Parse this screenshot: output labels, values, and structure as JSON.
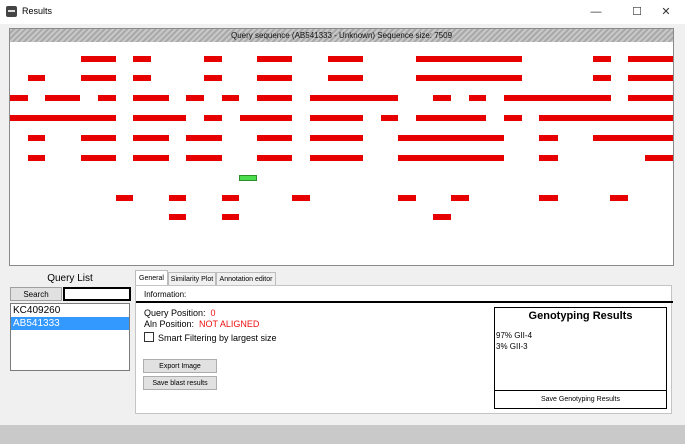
{
  "window": {
    "title": "Results",
    "minimize_glyph": "—",
    "maximize_glyph": "☐",
    "close_glyph": "✕",
    "icon": "app-logo-icon"
  },
  "plot": {
    "header": "Query sequence (AB541333 - Unknown) Sequence size: 7509",
    "red_color": "#e60000",
    "green_color": "#4cdd4c",
    "rows": [
      [
        [
          71,
          106
        ],
        [
          123,
          141
        ],
        [
          194,
          212
        ],
        [
          247,
          282
        ],
        [
          318,
          353
        ],
        [
          406,
          512
        ],
        [
          583,
          601
        ],
        [
          618,
          663
        ]
      ],
      [
        [
          18,
          35
        ],
        [
          71,
          106
        ],
        [
          123,
          141
        ],
        [
          194,
          212
        ],
        [
          247,
          282
        ],
        [
          318,
          353
        ],
        [
          406,
          512
        ],
        [
          583,
          601
        ],
        [
          618,
          663
        ]
      ],
      [
        [
          0,
          18
        ],
        [
          35,
          70
        ],
        [
          88,
          106
        ],
        [
          123,
          159
        ],
        [
          176,
          194
        ],
        [
          212,
          229
        ],
        [
          247,
          282
        ],
        [
          300,
          388
        ],
        [
          423,
          441
        ],
        [
          459,
          476
        ],
        [
          494,
          601
        ],
        [
          618,
          663
        ]
      ],
      [
        [
          0,
          53
        ],
        [
          53,
          106
        ],
        [
          123,
          176
        ],
        [
          194,
          212
        ],
        [
          230,
          282
        ],
        [
          300,
          353
        ],
        [
          371,
          388
        ],
        [
          406,
          476
        ],
        [
          494,
          512
        ],
        [
          529,
          663
        ]
      ],
      [
        [
          18,
          35
        ],
        [
          71,
          106
        ],
        [
          123,
          159
        ],
        [
          176,
          212
        ],
        [
          247,
          282
        ],
        [
          300,
          353
        ],
        [
          388,
          494
        ],
        [
          529,
          548
        ],
        [
          583,
          663
        ]
      ],
      [
        [
          18,
          35
        ],
        [
          71,
          106
        ],
        [
          123,
          159
        ],
        [
          176,
          212
        ],
        [
          247,
          282
        ],
        [
          300,
          353
        ],
        [
          388,
          494
        ],
        [
          529,
          548
        ],
        [
          635,
          663
        ]
      ],
      [
        [
          106,
          123
        ],
        [
          159,
          176
        ],
        [
          212,
          229
        ],
        [
          282,
          300
        ],
        [
          388,
          406
        ],
        [
          441,
          459
        ],
        [
          529,
          548
        ],
        [
          600,
          618
        ]
      ],
      [
        [
          159,
          176
        ],
        [
          212,
          229
        ],
        [
          423,
          441
        ]
      ]
    ],
    "row_tops": [
      56,
      75,
      95,
      115,
      135,
      155,
      195,
      214
    ],
    "green_segment": [
      229,
      247,
      175
    ]
  },
  "query_list": {
    "title": "Query List",
    "search_label": "Search",
    "search_value": "",
    "items": [
      "KC409260",
      "AB541333"
    ],
    "selected_index": 1
  },
  "tabs": [
    "General",
    "Similarity Plot",
    "Annotation editor"
  ],
  "active_tab": 0,
  "info": {
    "header": "Information:",
    "query_position_label": "Query Position:",
    "query_position_value": "0",
    "aln_position_label": "Aln Position:",
    "aln_position_value": "NOT ALIGNED",
    "smart_filter_label": "Smart Filtering by largest size",
    "smart_filter_checked": false,
    "export_image_label": "Export Image",
    "save_blast_label": "Save blast results"
  },
  "genotyping": {
    "title": "Genotyping Results",
    "results": [
      "97% GII-4",
      "3% GII-3"
    ],
    "save_label": "Save Genotyping Results"
  }
}
